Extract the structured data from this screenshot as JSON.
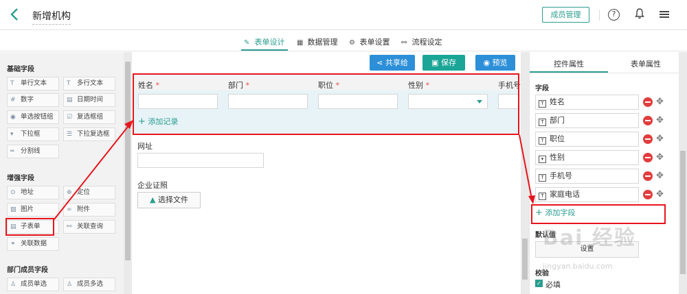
{
  "header": {
    "title": "新增机构",
    "member_button": "成员管理",
    "help": "?",
    "bell": "🔔",
    "menu": "≡"
  },
  "tabs": [
    {
      "label": "表单设计",
      "icon": "✎",
      "active": true
    },
    {
      "label": "数据管理",
      "icon": "▦",
      "active": false
    },
    {
      "label": "表单设置",
      "icon": "⚙",
      "active": false
    },
    {
      "label": "流程设定",
      "icon": "⚯",
      "active": false
    }
  ],
  "palette": {
    "basic_title": "基础字段",
    "basic": [
      {
        "label": "单行文本",
        "icon": "T"
      },
      {
        "label": "多行文本",
        "icon": "T"
      },
      {
        "label": "数字",
        "icon": "#"
      },
      {
        "label": "日期时间",
        "icon": "▤"
      },
      {
        "label": "单选按钮组",
        "icon": "◉"
      },
      {
        "label": "复选框组",
        "icon": "☑"
      },
      {
        "label": "下拉框",
        "icon": "▾"
      },
      {
        "label": "下拉复选框",
        "icon": "☰"
      },
      {
        "label": "分割线",
        "icon": "═"
      }
    ],
    "enhanced_title": "增强字段",
    "enhanced": [
      {
        "label": "地址",
        "icon": "⊙"
      },
      {
        "label": "定位",
        "icon": "⊕"
      },
      {
        "label": "图片",
        "icon": "▨"
      },
      {
        "label": "附件",
        "icon": "∞"
      },
      {
        "label": "子表单",
        "icon": "▤"
      },
      {
        "label": "关联查询",
        "icon": "⚯"
      },
      {
        "label": "关联数据",
        "icon": "⚭"
      }
    ],
    "dept_title": "部门成员字段",
    "dept": [
      {
        "label": "成员单选",
        "icon": "♙"
      },
      {
        "label": "成员多选",
        "icon": "♙"
      }
    ]
  },
  "toolbar": {
    "share": "共享给",
    "save": "保存",
    "preview": "预览"
  },
  "subform": {
    "columns": [
      "姓名",
      "部门",
      "职位",
      "性别",
      "手机号"
    ],
    "required_mark": "*",
    "add_record": "添加记录"
  },
  "fields": {
    "website_label": "网址",
    "license_label": "企业证照",
    "upload_button": "选择文件"
  },
  "right_panel": {
    "tab_control": "控件属性",
    "tab_form": "表单属性",
    "fields_title": "字段",
    "field_items": [
      "姓名",
      "部门",
      "职位",
      "性别",
      "手机号",
      "家庭电话"
    ],
    "add_field": "添加字段",
    "default_title": "默认值",
    "default_button": "设置",
    "validate_title": "校验",
    "required_label": "必填"
  },
  "watermark": {
    "main": "Bai 经验",
    "sub": "jingyan.baidu.com"
  },
  "colors": {
    "accent": "#2a9d8f",
    "blue": "#2c8fd8",
    "red_annotation": "#e8141b",
    "required": "#e84a4a"
  }
}
